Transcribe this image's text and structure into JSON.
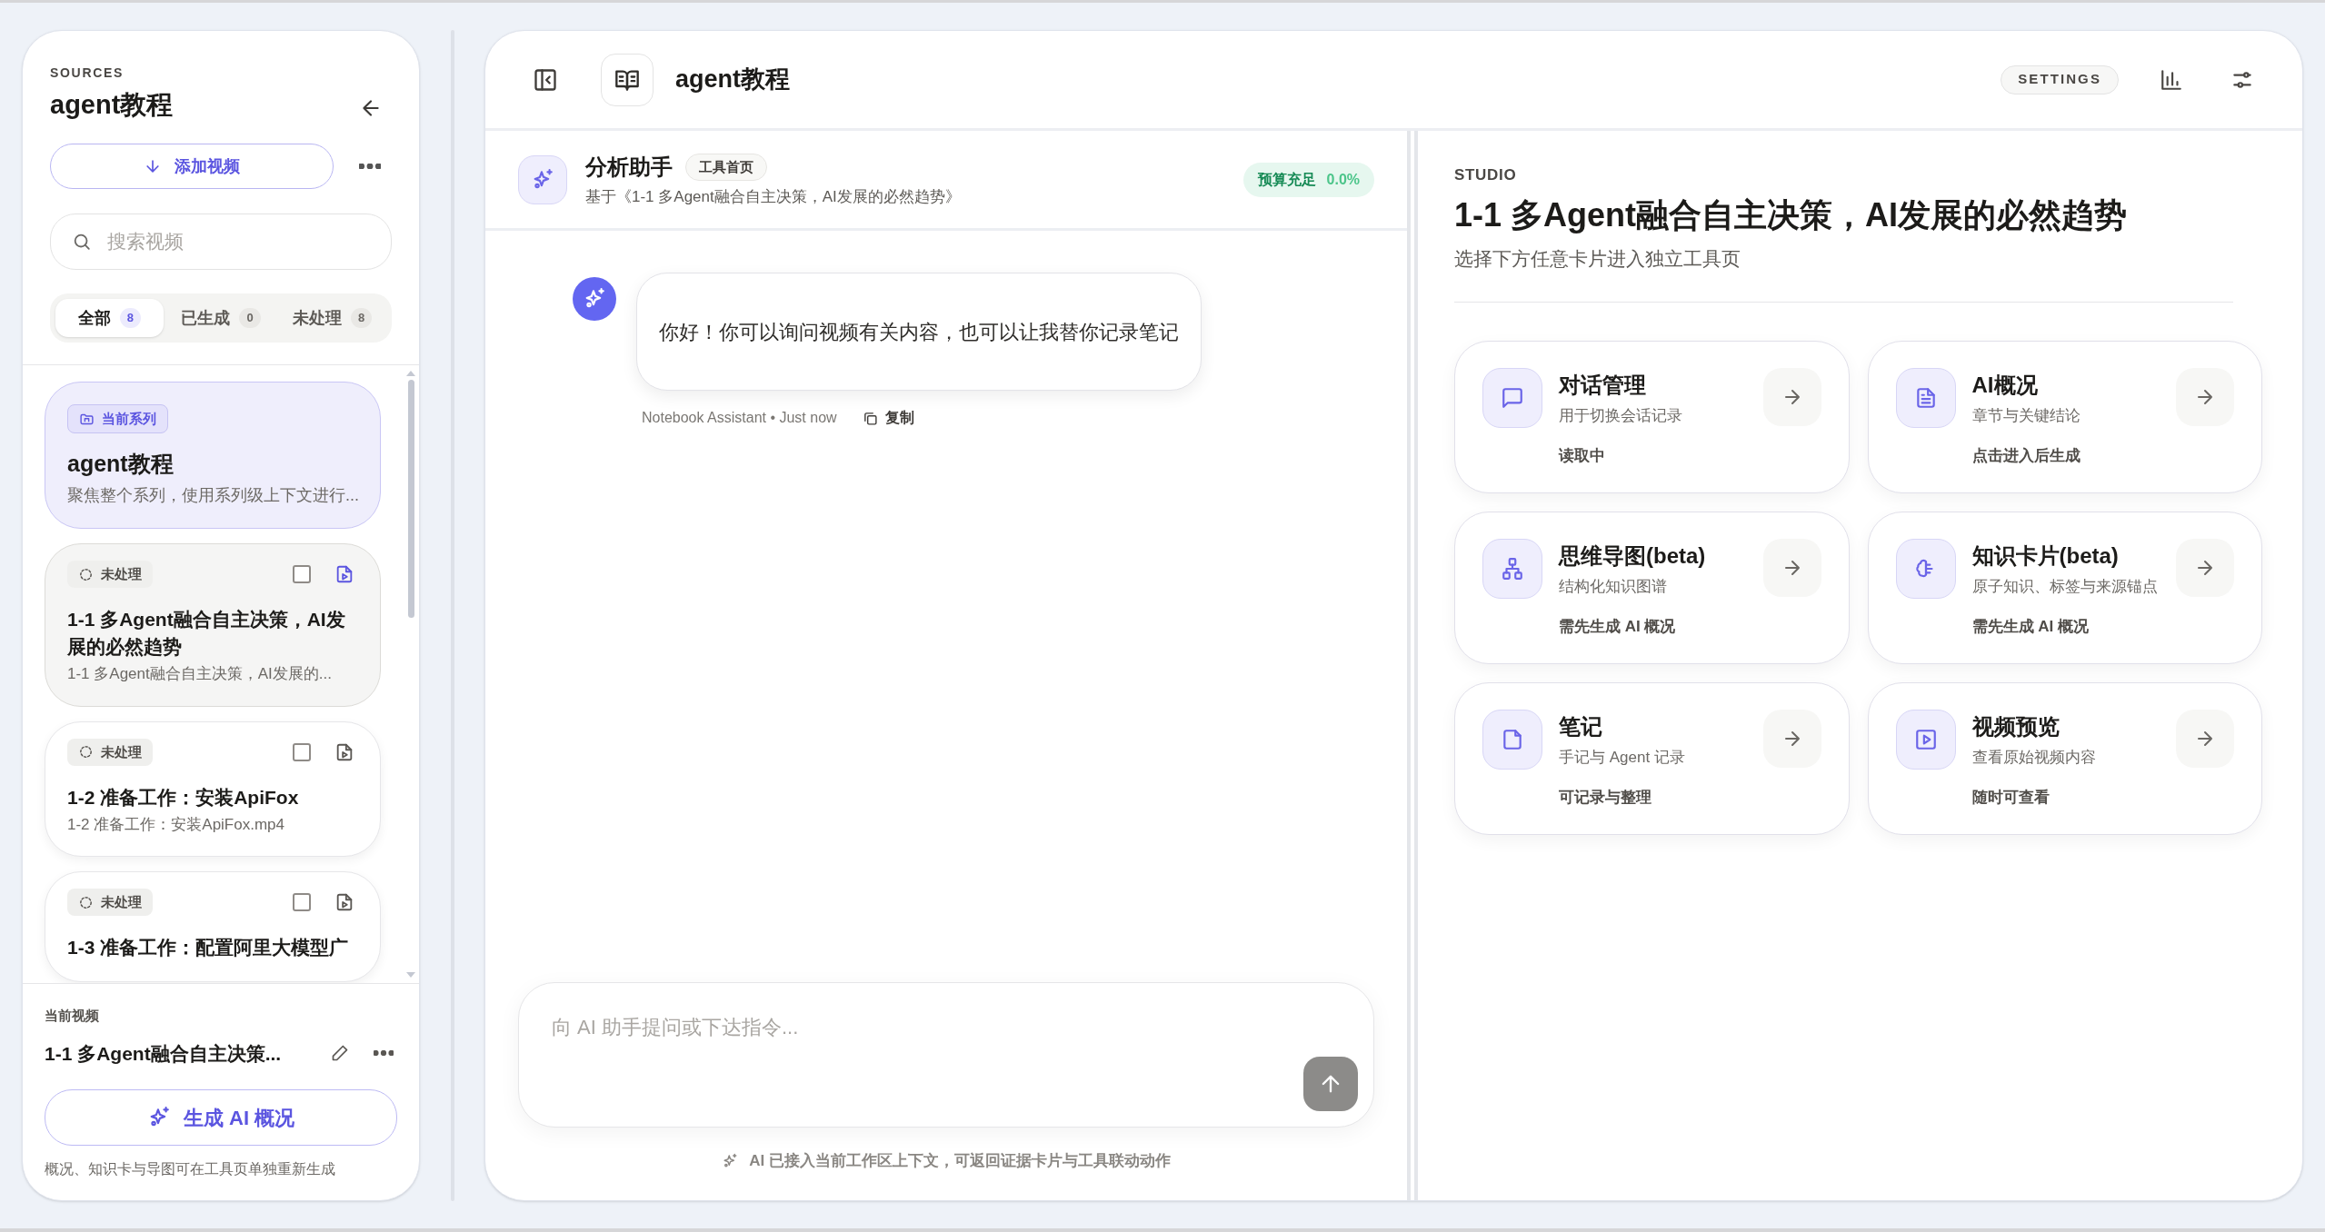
{
  "sidebar": {
    "section_label": "SOURCES",
    "title": "agent教程",
    "add_button": "添加视频",
    "search": {
      "placeholder": "搜索视频"
    },
    "filters": [
      {
        "label": "全部",
        "count": "8",
        "selected": true
      },
      {
        "label": "已生成",
        "count": "0",
        "selected": false
      },
      {
        "label": "未处理",
        "count": "8",
        "selected": false
      }
    ],
    "items": [
      {
        "kind": "series",
        "badge": "当前系列",
        "title": "agent教程",
        "subtitle": "聚焦整个系列，使用系列级上下文进行...",
        "selected": true
      },
      {
        "kind": "video",
        "status": "未处理",
        "title": "1-1 多Agent融合自主决策，AI发展的必然趋势",
        "subtitle": "1-1 多Agent融合自主决策，AI发展的...",
        "selected": true,
        "checked": false
      },
      {
        "kind": "video",
        "status": "未处理",
        "title": "1-2 准备工作：安装ApiFox",
        "subtitle": "1-2 准备工作：安装ApiFox.mp4",
        "selected": false,
        "checked": false
      },
      {
        "kind": "video",
        "status": "未处理",
        "title": "1-3 准备工作：配置阿里大模型广",
        "selected": false,
        "checked": false
      }
    ],
    "current": {
      "label": "当前视频",
      "title": "1-1 多Agent融合自主决策...",
      "generate_button": "生成 AI 概况",
      "note": "概况、知识卡与导图可在工具页单独重新生成"
    }
  },
  "header": {
    "title": "agent教程",
    "settings_button": "SETTINGS"
  },
  "chat": {
    "assistant_name": "分析助手",
    "badge": "工具首页",
    "context": "基于《1-1 多Agent融合自主决策，AI发展的必然趋势》",
    "budget": {
      "label": "预算充足",
      "value": "0.0%"
    },
    "messages": [
      {
        "text": "你好！你可以询问视频有关内容，也可以让我替你记录笔记",
        "meta": "Notebook Assistant • Just now",
        "copy": "复制"
      }
    ],
    "composer": {
      "placeholder": "向 AI 助手提问或下达指令..."
    },
    "footnote": "AI 已接入当前工作区上下文，可返回证据卡片与工具联动动作"
  },
  "studio": {
    "label": "STUDIO",
    "title": "1-1 多Agent融合自主决策，AI发展的必然趋势",
    "subtitle": "选择下方任意卡片进入独立工具页",
    "tools": [
      {
        "kind": "chat",
        "title": "对话管理",
        "description": "用于切换会话记录",
        "status": "读取中"
      },
      {
        "kind": "document",
        "title": "AI概况",
        "description": "章节与关键结论",
        "status": "点击进入后生成"
      },
      {
        "kind": "mindmap",
        "title": "思维导图(beta)",
        "description": "结构化知识图谱",
        "status": "需先生成 AI 概况"
      },
      {
        "kind": "brain",
        "title": "知识卡片(beta)",
        "description": "原子知识、标签与来源锚点",
        "status": "需先生成 AI 概况"
      },
      {
        "kind": "note",
        "title": "笔记",
        "description": "手记与 Agent 记录",
        "status": "可记录与整理"
      },
      {
        "kind": "video",
        "title": "视频预览",
        "description": "查看原始视频内容",
        "status": "随时可查看"
      }
    ]
  }
}
